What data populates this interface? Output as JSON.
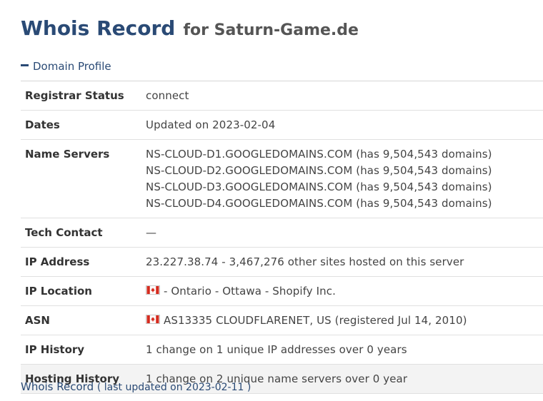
{
  "header": {
    "title": "Whois Record",
    "for_text": "for Saturn-Game.de"
  },
  "section": {
    "toggle_label": "Domain Profile"
  },
  "profile": {
    "registrar_status": {
      "label": "Registrar Status",
      "value": "connect"
    },
    "dates": {
      "label": "Dates",
      "value": "Updated on 2023-02-04"
    },
    "name_servers": {
      "label": "Name Servers",
      "values": [
        "NS-CLOUD-D1.GOOGLEDOMAINS.COM (has 9,504,543 domains)",
        "NS-CLOUD-D2.GOOGLEDOMAINS.COM (has 9,504,543 domains)",
        "NS-CLOUD-D3.GOOGLEDOMAINS.COM (has 9,504,543 domains)",
        "NS-CLOUD-D4.GOOGLEDOMAINS.COM (has 9,504,543 domains)"
      ]
    },
    "tech_contact": {
      "label": "Tech Contact",
      "value": "—"
    },
    "ip_address": {
      "label": "IP Address",
      "value": "23.227.38.74 - 3,467,276 other sites hosted on this server"
    },
    "ip_location": {
      "label": "IP Location",
      "value": "- Ontario - Ottawa - Shopify Inc.",
      "flag": "canada-flag-icon"
    },
    "asn": {
      "label": "ASN",
      "value": "AS13335 CLOUDFLARENET, US (registered Jul 14, 2010)",
      "flag": "canada-flag-icon"
    },
    "ip_history": {
      "label": "IP History",
      "value": "1 change on 1 unique IP addresses over 0 years"
    },
    "hosting_history": {
      "label": "Hosting History",
      "value": "1 change on 2 unique name servers over 0 year"
    }
  },
  "footer": {
    "link_label": "Whois Record",
    "note": "( last updated on 2023-02-11 )"
  },
  "colors": {
    "accent": "#2a4a75",
    "flag_red": "#d52b1e",
    "shaded_row": "#f3f3f3"
  }
}
